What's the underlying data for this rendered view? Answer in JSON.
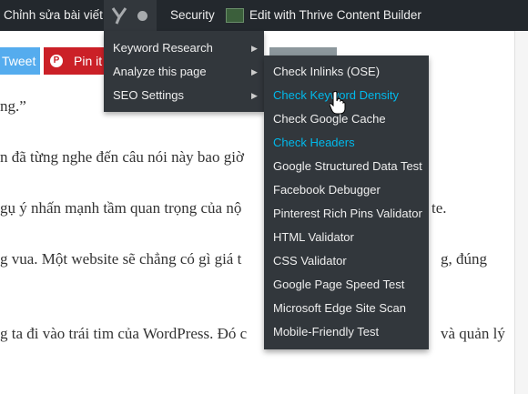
{
  "adminbar": {
    "edit_post": "Chỉnh sửa bài viết",
    "security": "Security",
    "thrive": "Edit with Thrive Content Builder"
  },
  "share": {
    "tweet": "Tweet",
    "pinit": "Pin it"
  },
  "content": {
    "p1": "ng.”",
    "p2": "n đã từng nghe đến câu nói này bao giờ",
    "p3": "gụ ý nhấn mạnh tầm quan trọng của nộ",
    "p3b": "te.",
    "p4": "g vua. Một website sẽ chẳng có gì giá t",
    "p4b": "g, đúng",
    "p5": "g ta đi vào trái tim của WordPress. Đó c",
    "p5b": "và quản lý"
  },
  "yoast_menu": {
    "items": [
      {
        "label": "Keyword Research"
      },
      {
        "label": "Analyze this page"
      },
      {
        "label": "SEO Settings"
      }
    ]
  },
  "analyze_submenu": {
    "items": [
      {
        "label": "Check Inlinks (OSE)",
        "highlight": false
      },
      {
        "label": "Check Keyword Density",
        "highlight": true
      },
      {
        "label": "Check Google Cache",
        "highlight": false
      },
      {
        "label": "Check Headers",
        "highlight": true
      },
      {
        "label": "Google Structured Data Test",
        "highlight": false
      },
      {
        "label": "Facebook Debugger",
        "highlight": false
      },
      {
        "label": "Pinterest Rich Pins Validator",
        "highlight": false
      },
      {
        "label": "HTML Validator",
        "highlight": false
      },
      {
        "label": "CSS Validator",
        "highlight": false
      },
      {
        "label": "Google Page Speed Test",
        "highlight": false
      },
      {
        "label": "Microsoft Edge Site Scan",
        "highlight": false
      },
      {
        "label": "Mobile-Friendly Test",
        "highlight": false
      }
    ]
  },
  "colors": {
    "adminbar_bg": "#23282d",
    "menu_bg": "#32373c",
    "highlight": "#00b9eb",
    "tweet": "#55acee",
    "pinterest": "#cb2027"
  }
}
